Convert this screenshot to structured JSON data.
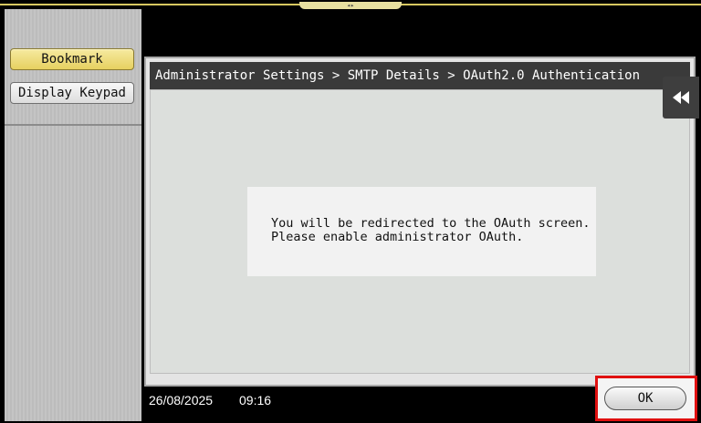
{
  "sidebar": {
    "bookmark_label": "Bookmark",
    "keypad_label": "Display Keypad"
  },
  "dialog": {
    "breadcrumb": "Administrator Settings > SMTP Details > OAuth2.0 Authentication",
    "message_line1": "You will be redirected to the OAuth screen.",
    "message_line2": "Please enable administrator OAuth."
  },
  "status": {
    "date": "26/08/2025",
    "time": "09:16"
  },
  "actions": {
    "ok_label": "OK"
  },
  "icons": {
    "rewind": "rewind-icon",
    "handle": "drag-handle-icon"
  },
  "colors": {
    "accent_bookmark": "#e6d060",
    "highlight": "#e01010",
    "header_bg": "#3a3a3a"
  }
}
